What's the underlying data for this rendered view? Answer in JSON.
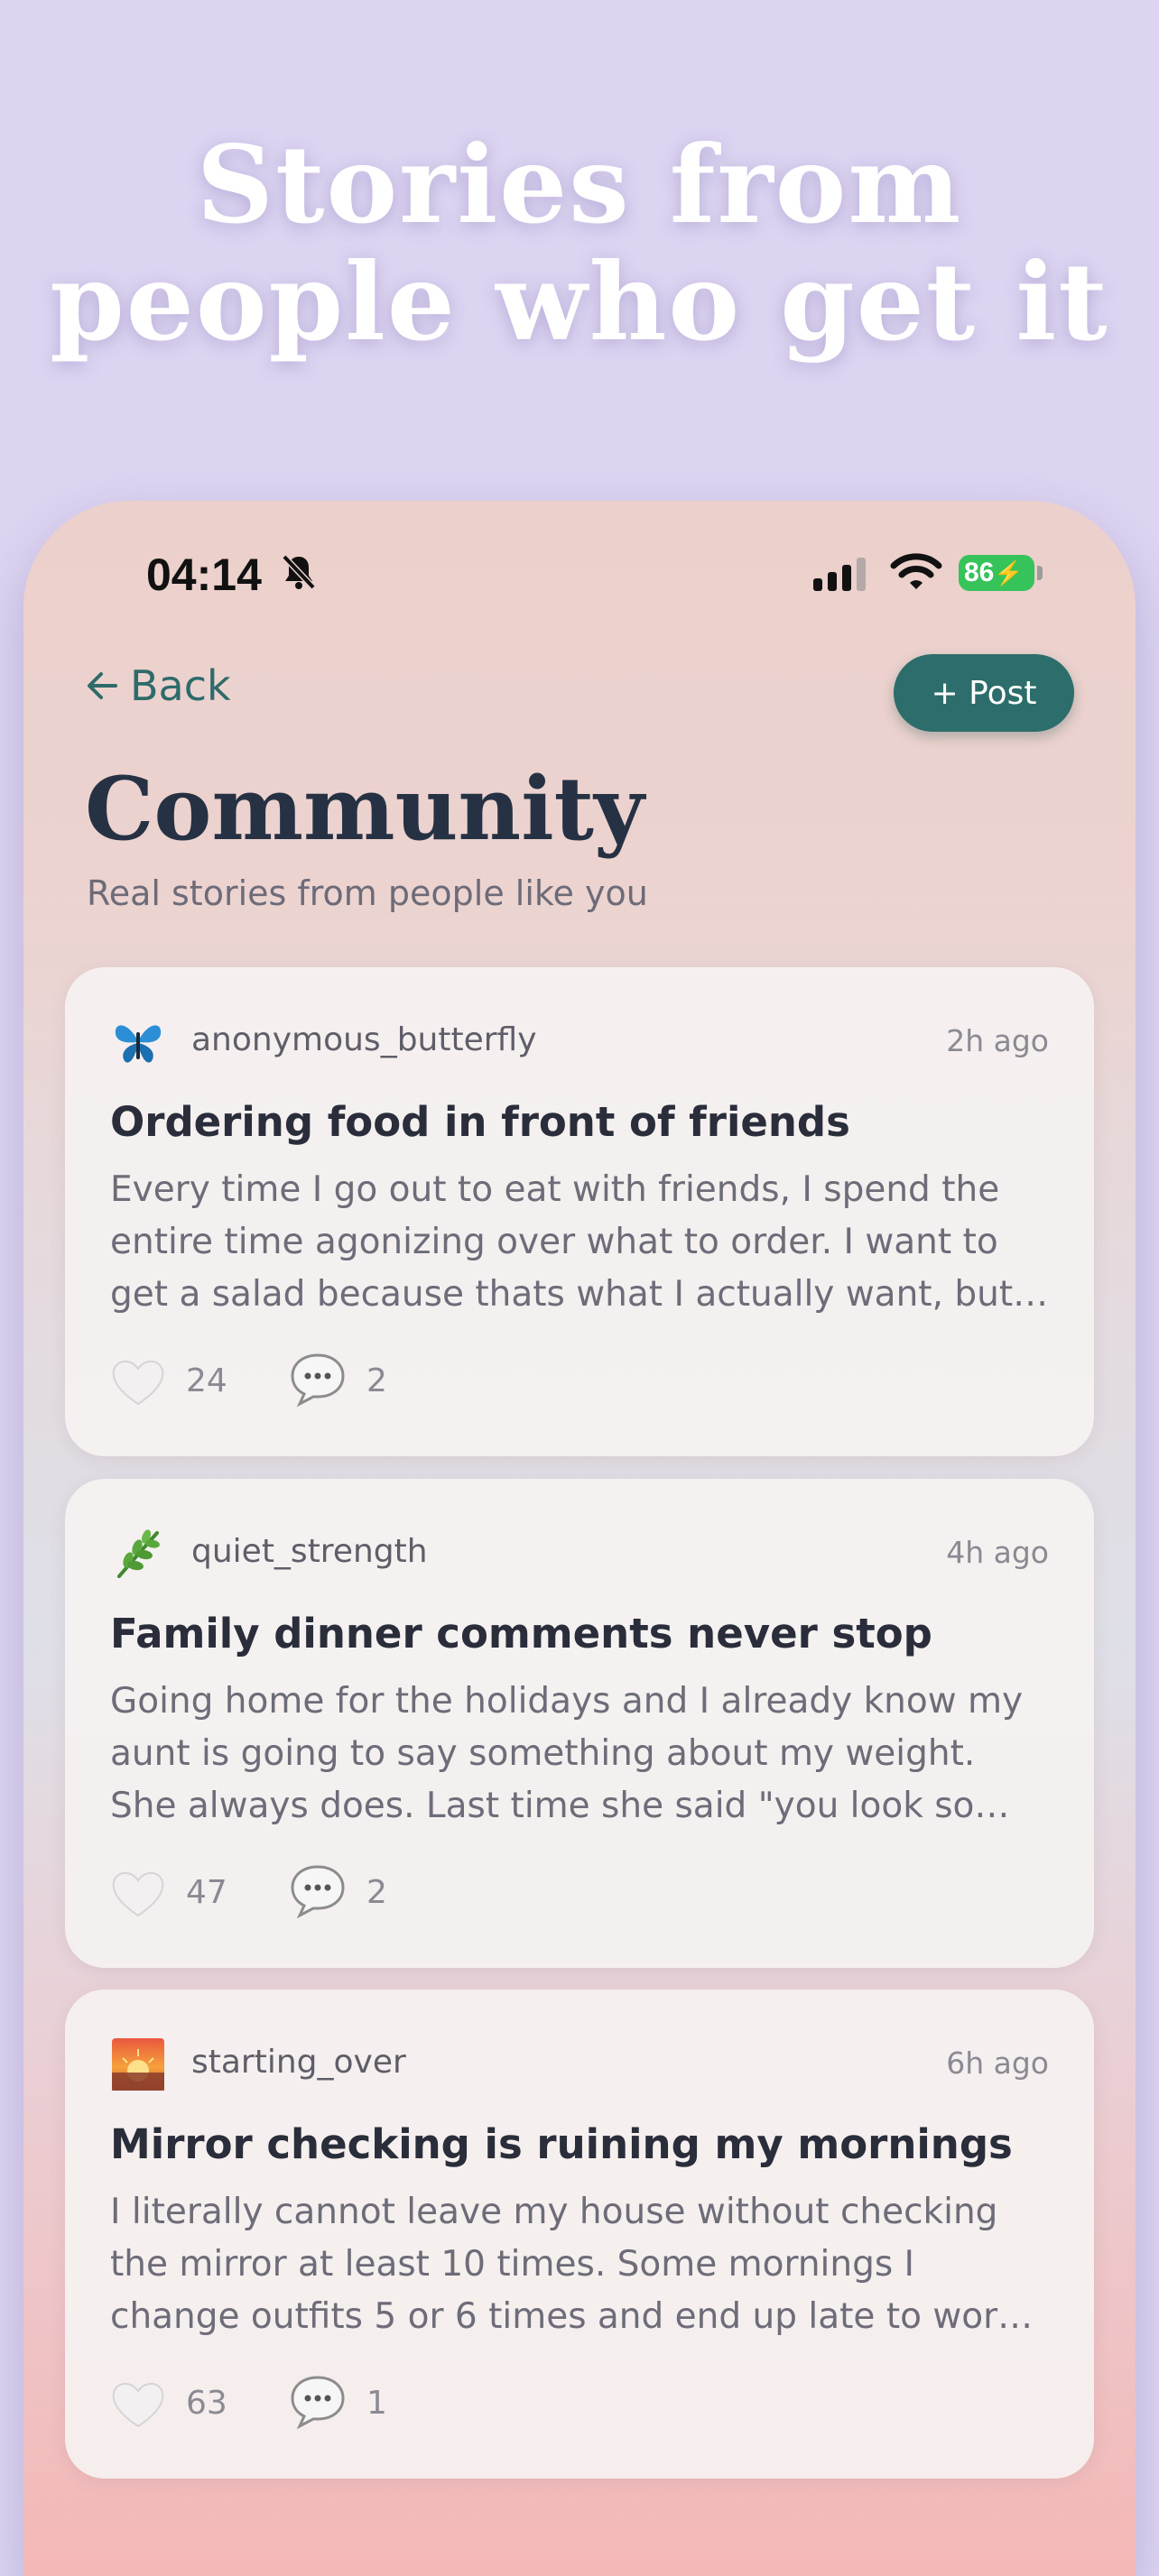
{
  "promo": {
    "headline_line1": "Stories from",
    "headline_line2": "people who get it"
  },
  "status_bar": {
    "time": "04:14",
    "battery": "86"
  },
  "nav": {
    "back_label": "Back",
    "post_label": "+ Post"
  },
  "header": {
    "title": "Community",
    "subtitle": "Real stories from people like you"
  },
  "posts": [
    {
      "avatar": "butterfly-icon",
      "username": "anonymous_butterfly",
      "time": "2h ago",
      "title": "Ordering food in front of friends",
      "excerpt": "Every time I go out to eat with friends, I spend the entire time agonizing over what to order. I want to get a salad because thats what I actually want, but…",
      "likes": "24",
      "comments": "2"
    },
    {
      "avatar": "herb-icon",
      "username": "quiet_strength",
      "time": "4h ago",
      "title": "Family dinner comments never stop",
      "excerpt": "Going home for the holidays and I already know my aunt is going to say something about my weight. She always does. Last time she said \"you look so di…",
      "likes": "47",
      "comments": "2"
    },
    {
      "avatar": "sunrise-icon",
      "username": "starting_over",
      "time": "6h ago",
      "title": "Mirror checking is ruining my mornings",
      "excerpt": "I literally cannot leave my house without checking the mirror at least 10 times. Some mornings I change outfits 5 or 6 times and end up late to wor…",
      "likes": "63",
      "comments": "1"
    }
  ],
  "colors": {
    "accent": "#2d6d6b",
    "title": "#263244",
    "background": "#dcd4f1"
  }
}
